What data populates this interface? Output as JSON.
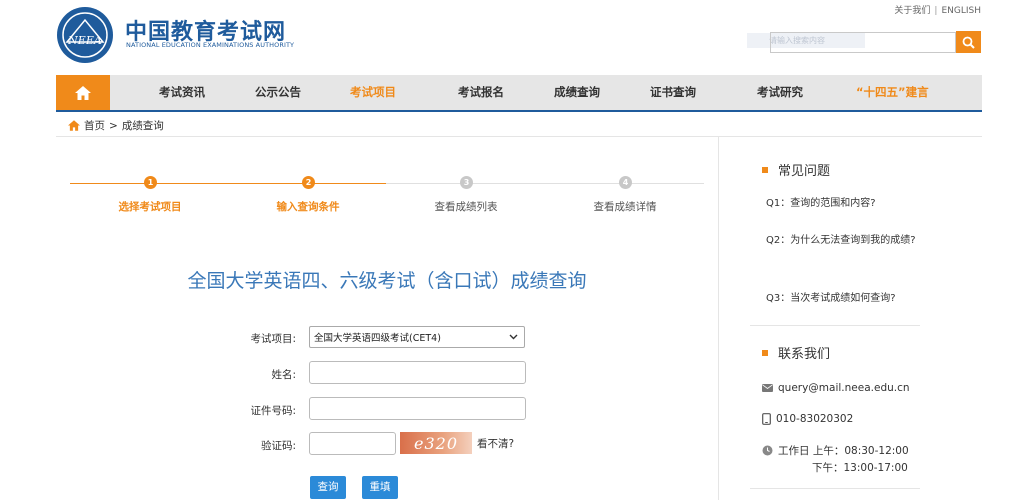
{
  "header": {
    "brand_cn": "中国教育考试网",
    "brand_en": "NATIONAL EDUCATION EXAMINATIONS AUTHORITY",
    "logo_text": "NEEA",
    "links": [
      "关于我们",
      "ENGLISH"
    ],
    "link_sep": "|",
    "search_hint": "请输入搜索内容",
    "search_value": ""
  },
  "nav": {
    "items": [
      "考试资讯",
      "公示公告",
      "考试项目",
      "考试报名",
      "成绩查询",
      "证书查询",
      "考试研究",
      "“十四五”建言"
    ],
    "active_index": 2
  },
  "breadcrumb": {
    "home": "首页",
    "sep": ">",
    "current": "成绩查询"
  },
  "steps": [
    {
      "num": "1",
      "label": "选择考试项目",
      "done": true
    },
    {
      "num": "2",
      "label": "输入查询条件",
      "done": true
    },
    {
      "num": "3",
      "label": "查看成绩列表",
      "done": false
    },
    {
      "num": "4",
      "label": "查看成绩详情",
      "done": false
    }
  ],
  "title": "全国大学英语四、六级考试（含口试）成绩查询",
  "form": {
    "exam_label": "考试项目:",
    "exam_value": "全国大学英语四级考试(CET4)",
    "name_label": "姓名:",
    "id_label": "证件号码:",
    "captcha_label": "验证码:",
    "captcha_text": "e320",
    "captcha_refresh": "看不清?",
    "submit": "查询",
    "reset": "重填"
  },
  "faq": {
    "heading": "常见问题",
    "q1": "Q1：查询的范围和内容?",
    "q2": "Q2：为什么无法查询到我的成绩?",
    "q3": "Q3：当次考试成绩如何查询?"
  },
  "contact": {
    "heading": "联系我们",
    "email": "query@mail.neea.edu.cn",
    "phone": "010-83020302",
    "hours_am": "工作日 上午：08:30-12:00",
    "hours_pm": "下午：13:00-17:00"
  },
  "colors": {
    "accent": "#f08a1a",
    "brand": "#1f5b9c",
    "button": "#2b8ad8"
  }
}
